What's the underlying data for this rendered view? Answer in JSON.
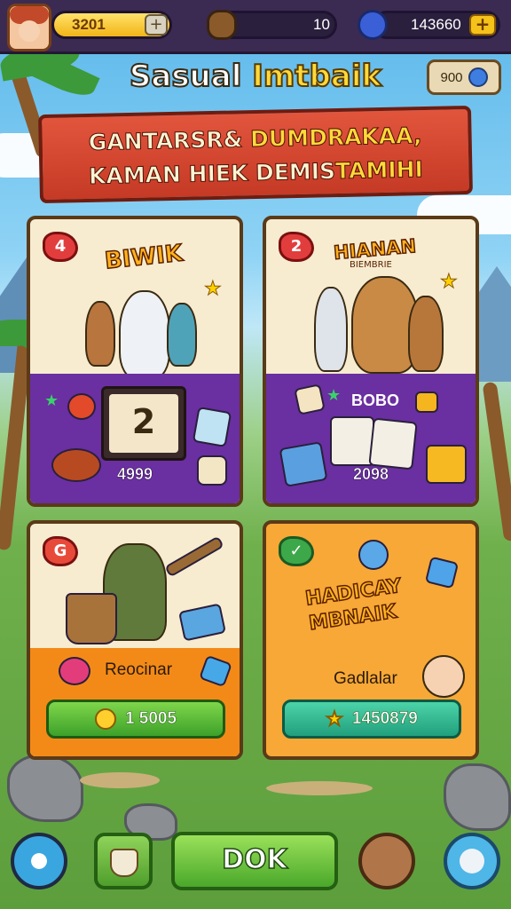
{
  "top_bar": {
    "gold_value": "3201",
    "wood_value": "10",
    "gems_value": "143660",
    "plus_label": "+"
  },
  "title": {
    "word1": "Sasual",
    "word2": "Imtbaik"
  },
  "badge": {
    "value": "900"
  },
  "banner": {
    "line1_a": "GANTARSR&",
    "line1_b": "DUMDRAKAA,",
    "line2_a": "KAMAN HIEK DEMIS",
    "line2_b": "TAMIHI"
  },
  "cards": [
    {
      "number": "4",
      "logo": "BIWIK",
      "price": "4999",
      "screen_num": "2"
    },
    {
      "number": "2",
      "logo": "HIANAN",
      "logo_sub": "BIEMBRIE",
      "tag": "BOBO",
      "price": "2098"
    },
    {
      "label": "Reocinar",
      "button_value": "1 5005"
    },
    {
      "logo_l1": "HADICAY",
      "logo_l2": "MBNAIK",
      "label": "Gadlalar",
      "button_value": "1450879"
    }
  ],
  "bottom": {
    "ok_label": "DOK"
  },
  "colors": {
    "accent_gold": "#f2b416",
    "purple": "#6a2fa0",
    "banner_red": "#c53a25",
    "ok_green": "#4aa82a"
  },
  "icons": [
    "avatar-icon",
    "wood-icon",
    "gem-icon",
    "globe-icon",
    "star-icon",
    "coin-icon",
    "gear-icon",
    "cup-icon",
    "plug-icon",
    "pet-icon"
  ]
}
